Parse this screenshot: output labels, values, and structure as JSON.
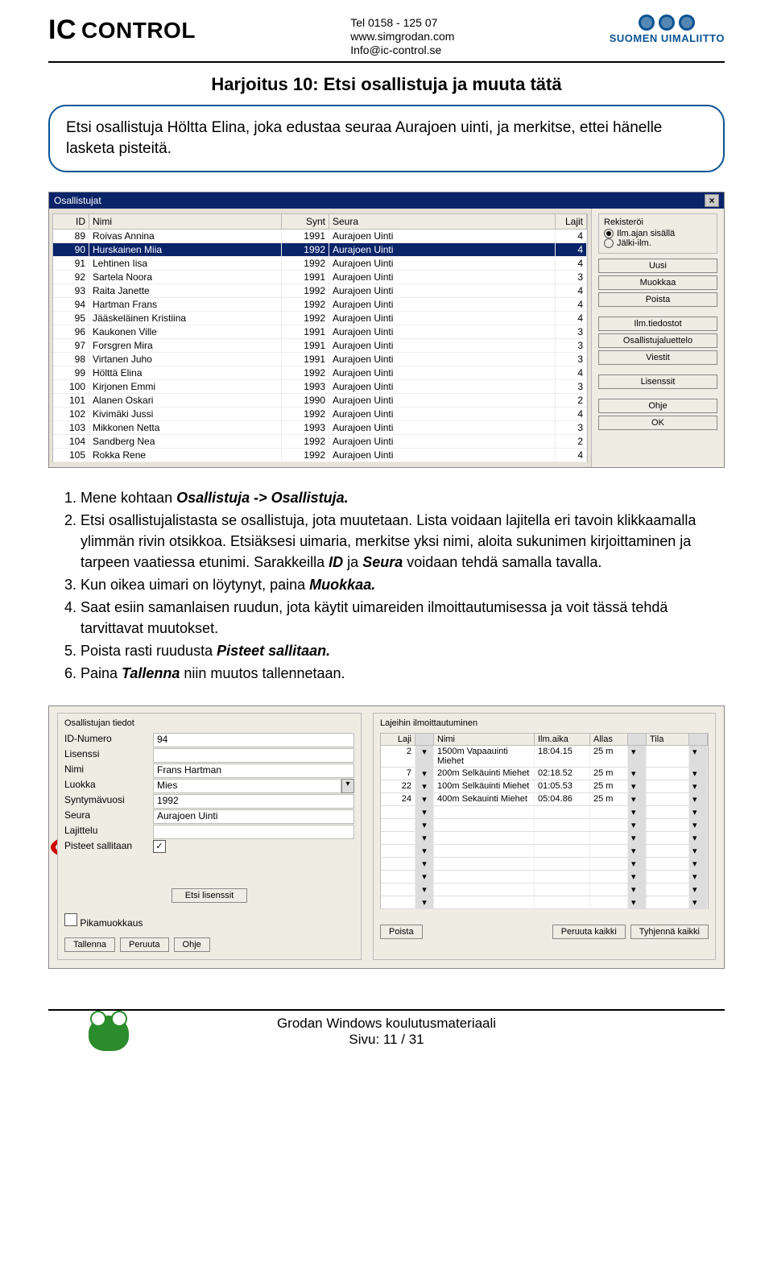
{
  "header": {
    "logo_left": "IC CONTROL",
    "contact_line1": "Tel 0158 - 125 07",
    "contact_line2": "www.simgrodan.com",
    "contact_line3": "Info@ic-control.se",
    "logo_right": "SUOMEN UIMALIITTO"
  },
  "title": "Harjoitus 10: Etsi osallistuja ja muuta tätä",
  "callout": "Etsi osallistuja Höltta Elina, joka edustaa seuraa Aurajoen uinti, ja merkitse, ettei hänelle lasketa pisteitä.",
  "window1": {
    "title": "Osallistujat",
    "cols": {
      "id": "ID",
      "nimi": "Nimi",
      "synt": "Synt",
      "seura": "Seura",
      "lajit": "Lajit"
    },
    "rows": [
      {
        "id": "89",
        "n": "Roivas Annina",
        "y": "1991",
        "c": "Aurajoen Uinti",
        "ct": "4"
      },
      {
        "id": "90",
        "n": "Hurskainen Miia",
        "y": "1992",
        "c": "Aurajoen Uinti",
        "ct": "4"
      },
      {
        "id": "91",
        "n": "Lehtinen Iisa",
        "y": "1992",
        "c": "Aurajoen Uinti",
        "ct": "4"
      },
      {
        "id": "92",
        "n": "Sartela Noora",
        "y": "1991",
        "c": "Aurajoen Uinti",
        "ct": "3"
      },
      {
        "id": "93",
        "n": "Raita Janette",
        "y": "1992",
        "c": "Aurajoen Uinti",
        "ct": "4"
      },
      {
        "id": "94",
        "n": "Hartman Frans",
        "y": "1992",
        "c": "Aurajoen Uinti",
        "ct": "4"
      },
      {
        "id": "95",
        "n": "Jääskeläinen Kristiina",
        "y": "1992",
        "c": "Aurajoen Uinti",
        "ct": "4"
      },
      {
        "id": "96",
        "n": "Kaukonen Ville",
        "y": "1991",
        "c": "Aurajoen Uinti",
        "ct": "3"
      },
      {
        "id": "97",
        "n": "Forsgren Mira",
        "y": "1991",
        "c": "Aurajoen Uinti",
        "ct": "3"
      },
      {
        "id": "98",
        "n": "Virtanen Juho",
        "y": "1991",
        "c": "Aurajoen Uinti",
        "ct": "3"
      },
      {
        "id": "99",
        "n": "Hölttä Elina",
        "y": "1992",
        "c": "Aurajoen Uinti",
        "ct": "4"
      },
      {
        "id": "100",
        "n": "Kirjonen Emmi",
        "y": "1993",
        "c": "Aurajoen Uinti",
        "ct": "3"
      },
      {
        "id": "101",
        "n": "Alanen Oskari",
        "y": "1990",
        "c": "Aurajoen Uinti",
        "ct": "2"
      },
      {
        "id": "102",
        "n": "Kivimäki Jussi",
        "y": "1992",
        "c": "Aurajoen Uinti",
        "ct": "4"
      },
      {
        "id": "103",
        "n": "Mikkonen Netta",
        "y": "1993",
        "c": "Aurajoen Uinti",
        "ct": "3"
      },
      {
        "id": "104",
        "n": "Sandberg Nea",
        "y": "1992",
        "c": "Aurajoen Uinti",
        "ct": "2"
      },
      {
        "id": "105",
        "n": "Rokka Rene",
        "y": "1992",
        "c": "Aurajoen Uinti",
        "ct": "4"
      }
    ],
    "side": {
      "group": "Rekisteröi",
      "r1": "Ilm.ajan sisällä",
      "r2": "Jälki-ilm.",
      "uusi": "Uusi",
      "muokkaa": "Muokkaa",
      "poista": "Poista",
      "ilm": "Ilm.tiedostot",
      "luett": "Osallistujaluettelo",
      "viestit": "Viestit",
      "lis": "Lisenssit",
      "ohje": "Ohje",
      "ok": "OK"
    }
  },
  "steps": {
    "s1a": "Mene kohtaan ",
    "s1b": "Osallistuja -> Osallistuja.",
    "s2a": "Etsi osallistujalistasta se osallistuja, jota muutetaan. Lista voidaan lajitella eri tavoin klikkaamalla ylimmän rivin otsikkoa. Etsiäksesi uimaria, merkitse yksi nimi, aloita sukunimen kirjoittaminen ja tarpeen vaatiessa etunimi. Sarakkeilla ",
    "s2b": "ID",
    "s2c": " ja ",
    "s2d": "Seura",
    "s2e": " voidaan tehdä samalla tavalla.",
    "s3a": "Kun oikea uimari on löytynyt, paina ",
    "s3b": "Muokkaa.",
    "s4": "Saat esiin samanlaisen ruudun, jota käytit uimareiden ilmoittautumisessa ja voit tässä tehdä tarvittavat muutokset.",
    "s5a": "Poista rasti ruudusta ",
    "s5b": "Pisteet sallitaan.",
    "s6a": "Paina ",
    "s6b": "Tallenna",
    "s6c": " niin muutos tallennetaan."
  },
  "window2": {
    "left_title": "Osallistujan tiedot",
    "fields": {
      "id": {
        "k": "ID-Numero",
        "v": "94"
      },
      "lis": {
        "k": "Lisenssi",
        "v": ""
      },
      "nimi": {
        "k": "Nimi",
        "v": "Frans Hartman"
      },
      "luokka": {
        "k": "Luokka",
        "v": "Mies"
      },
      "synt": {
        "k": "Syntymävuosi",
        "v": "1992"
      },
      "seura": {
        "k": "Seura",
        "v": "Aurajoen Uinti"
      },
      "laj": {
        "k": "Lajittelu",
        "v": ""
      },
      "pist": {
        "k": "Pisteet sallitaan"
      }
    },
    "etsi": "Etsi lisenssit",
    "pika": "Pikamuokkaus",
    "tallenna": "Tallenna",
    "peruuta": "Peruuta",
    "ohje": "Ohje",
    "right_title": "Lajeihin ilmoittautuminen",
    "cols": {
      "laji": "Laji",
      "nimi": "Nimi",
      "ilm": "Ilm.aika",
      "allas": "Allas",
      "tila": "Tila"
    },
    "events": [
      {
        "id": "2",
        "n": "1500m Vapaauinti Miehet",
        "t": "18:04.15",
        "p": "25 m"
      },
      {
        "id": "7",
        "n": "200m Selkäuinti Miehet",
        "t": "02:18.52",
        "p": "25 m"
      },
      {
        "id": "22",
        "n": "100m Selkäuinti Miehet",
        "t": "01:05.53",
        "p": "25 m"
      },
      {
        "id": "24",
        "n": "400m Sekauinti Miehet",
        "t": "05:04.86",
        "p": "25 m"
      }
    ],
    "poista": "Poista",
    "pkaikki": "Peruuta kaikki",
    "tkaikki": "Tyhjennä kaikki"
  },
  "footer": {
    "l1": "Grodan Windows koulutusmateriaali",
    "l2": "Sivu: 11 / 31"
  }
}
